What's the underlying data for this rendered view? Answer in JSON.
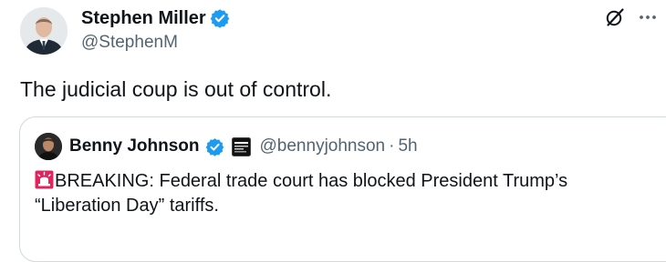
{
  "author": {
    "name": "Stephen Miller",
    "handle": "@StephenM",
    "avatar_icon": "person-avatar"
  },
  "actions": {
    "grok_icon": "grok-icon",
    "more_icon": "more-horizontal-icon"
  },
  "tweet": {
    "text": "The judicial coup is out of control."
  },
  "quote": {
    "author_name": "Benny Johnson",
    "handle": "@bennyjohnson",
    "separator": "·",
    "time": "5h",
    "affiliate_icon": "affiliate-badge-icon",
    "emoji_icon": "siren-emoji",
    "text_line1": "BREAKING: Federal trade court has blocked President Trump’s",
    "text_line2": "“Liberation Day” tariffs."
  },
  "colors": {
    "verified_blue": "#1d9bf0",
    "secondary_text": "#536471",
    "border": "#cfd9de",
    "primary_text": "#0f1419",
    "siren_red": "#e0245e"
  }
}
